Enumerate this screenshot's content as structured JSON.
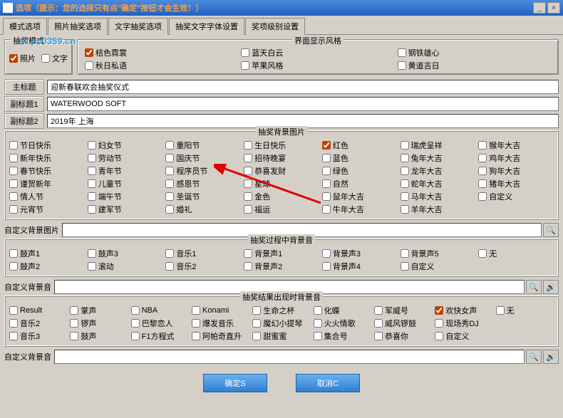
{
  "window": {
    "title": "选项（提示：您的选择只有点\"确定\"按钮才会生效！）"
  },
  "watermark": "w.pc0359.cn",
  "tabs": [
    "模式选项",
    "照片抽奖选项",
    "文字抽奖选项",
    "抽奖文字字体设置",
    "奖项级别设置"
  ],
  "mode": {
    "title": "抽奖模式",
    "opts": [
      "照片",
      "文字"
    ]
  },
  "style": {
    "title": "界面显示风格",
    "opts": [
      "桔色霓裳",
      "蓝天白云",
      "钢铁雄心",
      "秋日私语",
      "苹果风格",
      "黄道吉日"
    ]
  },
  "titles": {
    "main_lbl": "主标题",
    "main_val": "迎新春联欢会抽奖仪式",
    "sub1_lbl": "副标题1",
    "sub1_val": "WATERWOOD SOFT",
    "sub2_lbl": "副标题2",
    "sub2_val": "2019年 上海"
  },
  "bgimg": {
    "title": "抽奖背景图片",
    "items": [
      "节日快乐",
      "妇女节",
      "重阳节",
      "生日快乐",
      "红色",
      "瑞虎呈祥",
      "猴年大吉",
      "新年快乐",
      "劳动节",
      "国庆节",
      "招待晚宴",
      "蓝色",
      "兔年大吉",
      "鸡年大吉",
      "春节快乐",
      "青年节",
      "程序员节",
      "恭喜发财",
      "绿色",
      "龙年大吉",
      "狗年大吉",
      "谨贺新年",
      "儿童节",
      "感恩节",
      "星球",
      "自然",
      "蛇年大吉",
      "猪年大吉",
      "情人节",
      "端午节",
      "圣诞节",
      "金色",
      "鼠年大吉",
      "马年大吉",
      "自定义",
      "元宵节",
      "建军节",
      "婚礼",
      "福运",
      "牛年大吉",
      "羊年大吉",
      ""
    ],
    "checked_idx": 4,
    "custom_lbl": "自定义背景图片"
  },
  "bgm_during": {
    "title": "抽奖过程中背景音",
    "items": [
      "鼓声1",
      "鼓声3",
      "音乐1",
      "背景声1",
      "背景声3",
      "背景声5",
      "无",
      "鼓声2",
      "滚动",
      "音乐2",
      "背景声2",
      "背景声4",
      "自定义",
      ""
    ],
    "custom_lbl": "自定义背景音"
  },
  "bgm_result": {
    "title": "抽奖结果出现时背景音",
    "items": [
      "Result",
      "掌声",
      "NBA",
      "Konami",
      "生命之杯",
      "化蝶",
      "军威号",
      "欢快女声",
      "无",
      "音乐2",
      "锣声",
      "巴黎恋人",
      "爆发音乐",
      "魔幻小提琴",
      "火火情歌",
      "威风锣鼓",
      "现场秀DJ",
      "",
      "音乐3",
      "鼓声",
      "F1方程式",
      "阿帕奇直升",
      "甜蜜蜜",
      "集合号",
      "恭喜你",
      "自定义",
      ""
    ],
    "checked_idx": 7,
    "custom_lbl": "自定义背景音"
  },
  "buttons": {
    "ok": "确定S",
    "cancel": "取消C"
  }
}
